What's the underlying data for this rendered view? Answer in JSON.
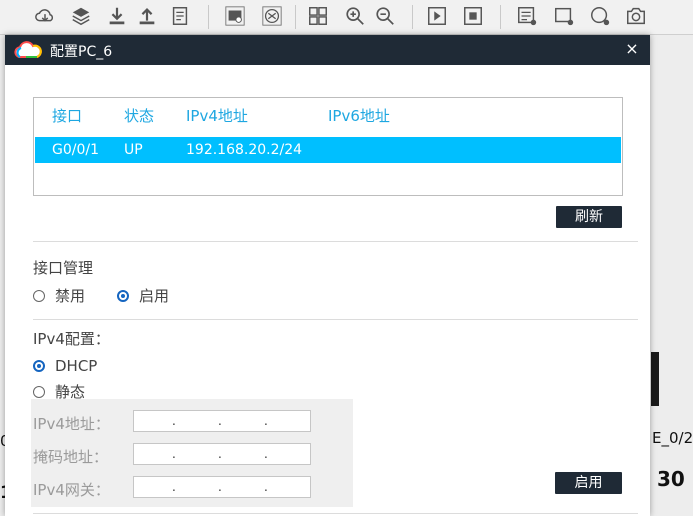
{
  "canvas": {
    "partial_label_left": "0",
    "partial_label_left2": "1",
    "partial_label_right": "E_0/2",
    "partial_number_right": "30"
  },
  "toolbar": {
    "icons": [
      "cloud-download-icon",
      "layers-icon",
      "download-icon",
      "upload-icon",
      "document-icon",
      "screenshot-icon",
      "topology-icon",
      "grid-icon",
      "zoom-in-icon",
      "zoom-out-icon",
      "play-icon",
      "stop-icon",
      "add-text-icon",
      "add-rect-icon",
      "add-ellipse-icon",
      "camera-icon"
    ]
  },
  "dialog": {
    "title": "配置PC_6",
    "close_label": "×",
    "table": {
      "headers": [
        "接口",
        "状态",
        "IPv4地址",
        "IPv6地址"
      ],
      "rows": [
        {
          "interface": "G0/0/1",
          "status": "UP",
          "ipv4": "192.168.20.2/24",
          "ipv6": ""
        }
      ]
    },
    "refresh_label": "刷新",
    "iface_mgmt": {
      "label": "接口管理",
      "options": [
        "禁用",
        "启用"
      ],
      "selected": "启用"
    },
    "ipv4_config": {
      "label": "IPv4配置：",
      "options": [
        "DHCP",
        "静态"
      ],
      "selected": "DHCP",
      "fields": [
        {
          "label": "IPv4地址：",
          "value": ". . ."
        },
        {
          "label": "掩码地址：",
          "value": ". . ."
        },
        {
          "label": "IPv4网关：",
          "value": ". . ."
        }
      ]
    },
    "apply_label": "启用",
    "colors": {
      "accent": "#1ea7e1",
      "selected_row": "#00bfff",
      "titlebar": "#1f2a36"
    }
  }
}
